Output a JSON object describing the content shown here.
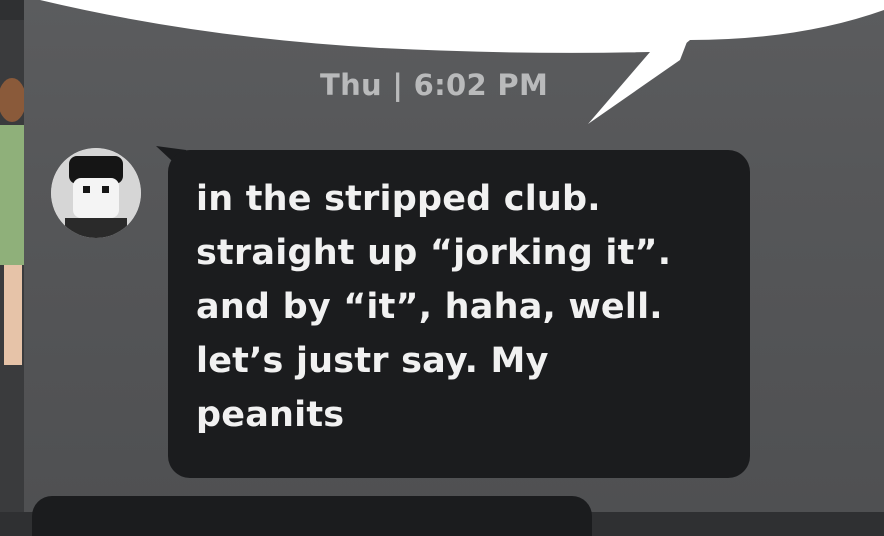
{
  "chat": {
    "timestamp": "Thu | 6:02 PM",
    "messages": [
      {
        "text": "in the stripped club.\nstraight up “jorking it”.\nand by “it”, haha, well.\nlet’s justr say. My\npeanits"
      }
    ]
  },
  "colors": {
    "panel": "#58595b",
    "bubble": "#1b1c1e",
    "message_text": "#f1f1f1",
    "timestamp_text": "#b9babb"
  }
}
